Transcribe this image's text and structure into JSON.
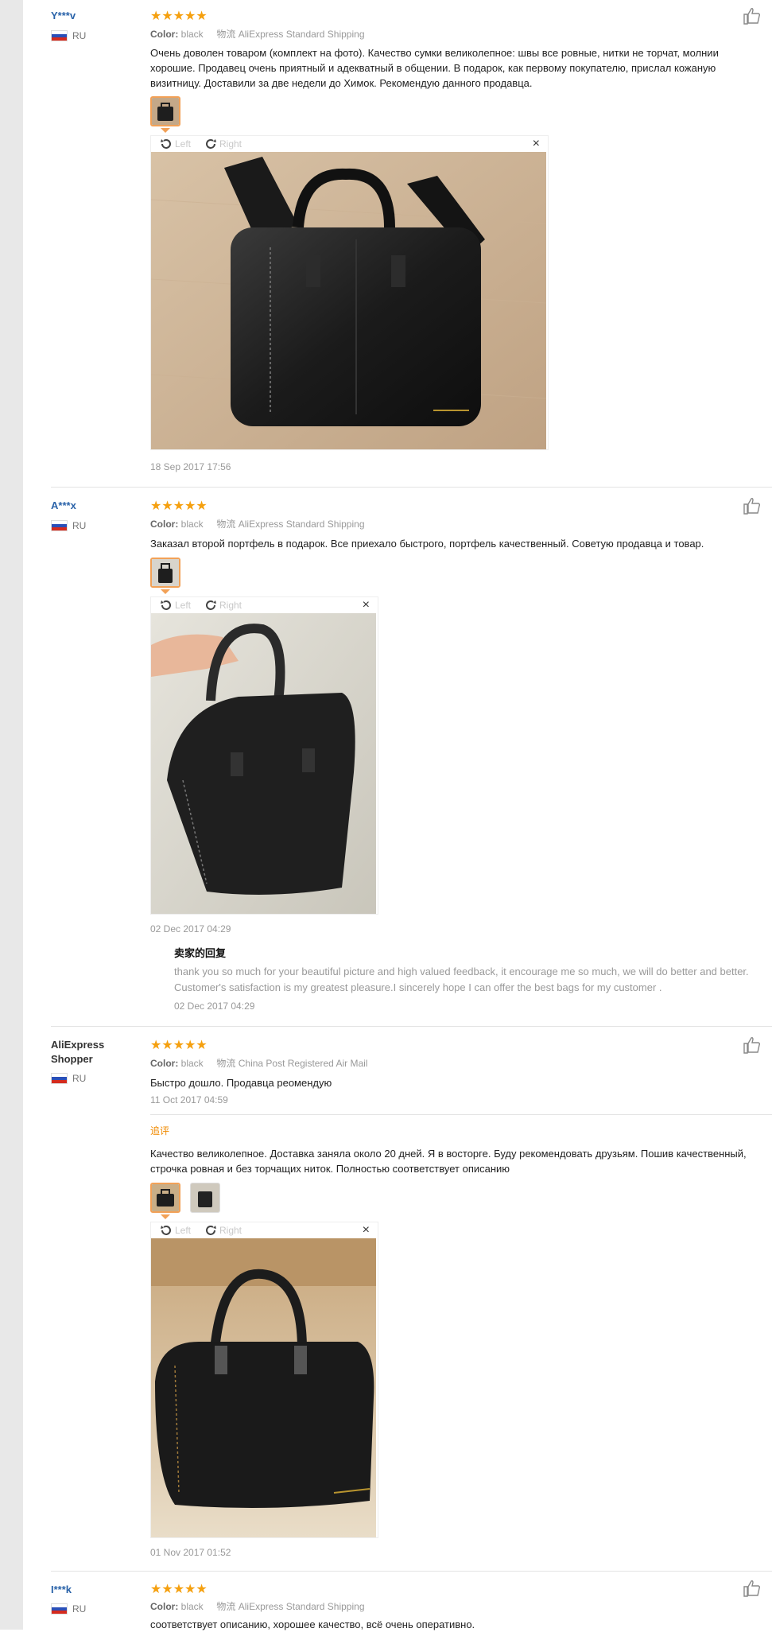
{
  "reviews": [
    {
      "user": "Y***v",
      "country": "RU",
      "stars": "★★★★★",
      "color_label": "Color:",
      "color_value": "black",
      "ship_label": "物流",
      "shipping": "AliExpress Standard Shipping",
      "text": "Очень доволен товаром (комплект на фото). Качество сумки великолепное: швы все ровные, нитки не торчат, молнии хорошие. Продавец очень приятный и адекватный в общении. В подарок, как первому покупателю, прислал кожаную визитницу. Доставили за две недели до Химок. Рекомендую данного продавца.",
      "date": "18 Sep 2017 17:56"
    },
    {
      "user": "A***x",
      "country": "RU",
      "stars": "★★★★★",
      "color_label": "Color:",
      "color_value": "black",
      "ship_label": "物流",
      "shipping": "AliExpress Standard Shipping",
      "text": "Заказал второй портфель в подарок. Все приехало быстрого, портфель качественный. Советую продавца и товар.",
      "date": "02 Dec 2017 04:29",
      "reply_title": "卖家的回复",
      "reply_text": "thank you so much for your beautiful picture and high valued feedback, it encourage me so much, we will do better and better. Customer's satisfaction is my greatest pleasure.I sincerely hope I can offer the best bags for my customer .",
      "reply_date": "02 Dec 2017 04:29"
    },
    {
      "user": "AliExpress Shopper",
      "country": "RU",
      "stars": "★★★★★",
      "color_label": "Color:",
      "color_value": "black",
      "ship_label": "物流",
      "shipping": "China Post Registered Air Mail",
      "text": "Быстро дошло. Продавца реомендую",
      "date": "11 Oct 2017 04:59",
      "followup_label": "追评",
      "followup_text": "Качество великолепное. Доставка заняла около 20 дней. Я в восторге. Буду рекомендовать друзьям. Пошив качественный, строчка ровная и без торчащих ниток. Полностью соответствует описанию",
      "followup_date": "01 Nov 2017 01:52"
    },
    {
      "user": "I***k",
      "country": "RU",
      "stars": "★★★★★",
      "color_label": "Color:",
      "color_value": "black",
      "ship_label": "物流",
      "shipping": "AliExpress Standard Shipping",
      "text": "соответствует описанию, хорошее качество, всё очень оперативно."
    }
  ],
  "viewer": {
    "left_label": "Left",
    "right_label": "Right",
    "close_glyph": "×"
  },
  "icons": {
    "rotate_left": "rotate-left-icon",
    "rotate_right": "rotate-right-icon",
    "like": "thumbs-up-icon",
    "flag": "russia-flag-icon"
  }
}
